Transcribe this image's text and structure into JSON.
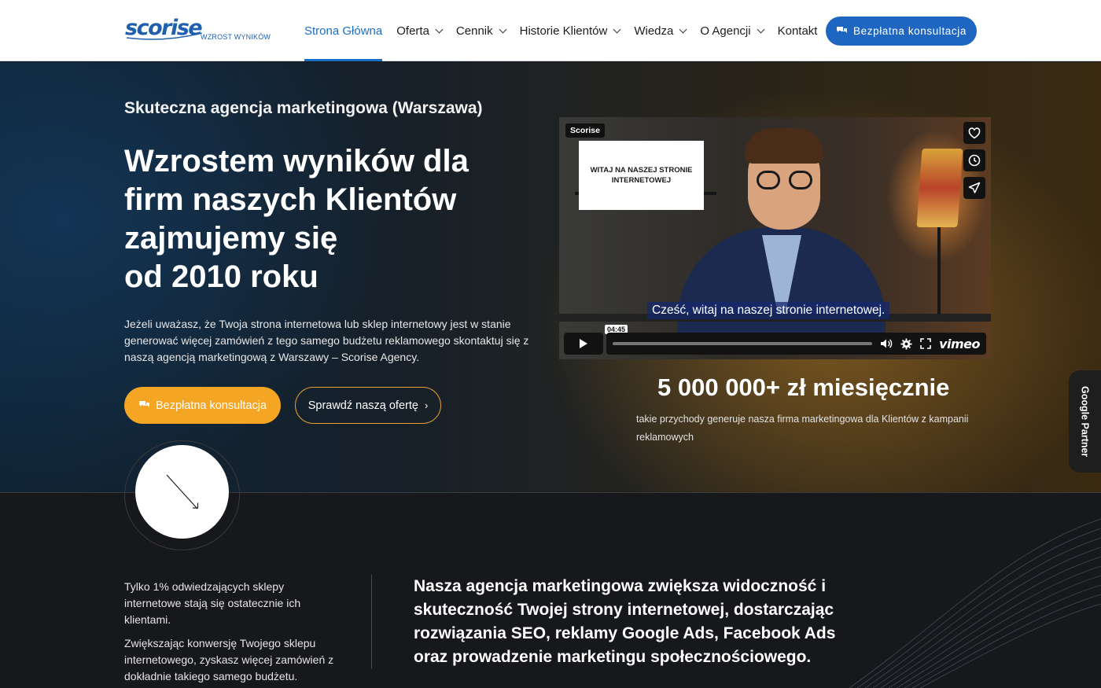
{
  "nav": {
    "logo_text": "scorise",
    "logo_subtitle": "WZROST WYNIKÓW",
    "items": [
      {
        "label": "Strona Główna",
        "active": true,
        "dropdown": false
      },
      {
        "label": "Oferta",
        "active": false,
        "dropdown": true
      },
      {
        "label": "Cennik",
        "active": false,
        "dropdown": true
      },
      {
        "label": "Historie Klientów",
        "active": false,
        "dropdown": true
      },
      {
        "label": "Wiedza",
        "active": false,
        "dropdown": true
      },
      {
        "label": "O Agencji",
        "active": false,
        "dropdown": true
      },
      {
        "label": "Kontakt",
        "active": false,
        "dropdown": false
      }
    ],
    "cta_label": "Bezpłatna konsultacja"
  },
  "hero": {
    "kicker": "Skuteczna agencja marketingowa (Warszawa)",
    "headline_lines": [
      "Wzrostem wyników dla",
      "firm naszych Klientów",
      "zajmujemy się",
      "od 2010 roku"
    ],
    "lead": "Jeżeli uważasz, że Twoja strona internetowa lub sklep internetowy jest w stanie generować więcej zamówień z tego samego budżetu reklamowego skontaktuj się z naszą agencją marketingową z Warszawy – Scorise Agency.",
    "primary_button": "Bezpłatna konsultacja",
    "secondary_button": "Sprawdź naszą ofertę",
    "secondary_button_arrow": "›"
  },
  "video": {
    "tag": "Scorise",
    "card_text": "WITAJ NA NASZEJ STRONIE INTERNETOWEJ",
    "caption": "Cześć, witaj na naszej stronie internetowej.",
    "time": "04:45",
    "progress": 0,
    "brand": "vimeo",
    "side_icons": [
      "heart-icon",
      "clock-icon",
      "send-icon"
    ]
  },
  "stat": {
    "value": "5 000 000+ zł miesięcznie",
    "description": "takie przychody generuje nasza firma marketingowa dla Klientów z kampanii reklamowych"
  },
  "side_tab": "Google Partner",
  "lower": {
    "paragraphs": [
      "Tylko 1% odwiedzających sklepy internetowe stają się ostatecznie ich klientami.",
      "Zwiększając konwersję Twojego sklepu internetowego, zyskasz więcej zamówień z dokładnie takiego samego budżetu."
    ],
    "heading": "Nasza agencja marketingowa zwiększa widoczność i skuteczność Twojej strony internetowej, dostarczając rozwiązania SEO, reklamy Google Ads, Facebook Ads oraz prowadzenie marketingu społecznościowego."
  },
  "colors": {
    "brand_blue": "#1f66c1",
    "accent_orange": "#f5a524",
    "nav_active": "#1c6fc6"
  }
}
